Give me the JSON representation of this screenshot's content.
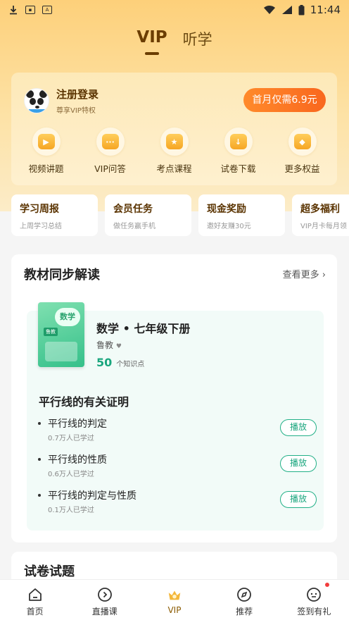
{
  "status_bar": {
    "time": "11:44",
    "left_icons": [
      "download-icon",
      "app-badge-icon",
      "a-icon"
    ],
    "right_icons": [
      "wifi-icon",
      "signal-icon",
      "battery-icon"
    ]
  },
  "top_tabs": [
    {
      "label": "VIP",
      "active": true
    },
    {
      "label": "听学",
      "active": false
    }
  ],
  "vip_card": {
    "login_title": "注册登录",
    "login_subtitle": "尊享VIP特权",
    "first_month_button": "首月仅需6.9元",
    "benefits": [
      {
        "label": "视频讲题",
        "icon": "video-icon"
      },
      {
        "label": "VIP问答",
        "icon": "chat-icon"
      },
      {
        "label": "考点课程",
        "icon": "star-icon"
      },
      {
        "label": "试卷下载",
        "icon": "download-icon"
      },
      {
        "label": "更多权益",
        "icon": "gift-icon"
      }
    ]
  },
  "quick_cards": [
    {
      "title": "学习周报",
      "subtitle": "上周学习总结"
    },
    {
      "title": "会员任务",
      "subtitle": "做任务赢手机"
    },
    {
      "title": "现金奖励",
      "subtitle": "邀好友赚30元"
    },
    {
      "title": "超多福利",
      "subtitle": "VIP月卡每月领"
    }
  ],
  "textbook_section": {
    "title": "教材同步解读",
    "see_more": "查看更多",
    "book": {
      "cover_badge": "数学",
      "cover_tag": "鲁教",
      "name": "数学 • 七年级下册",
      "publisher": "鲁教",
      "knowledge_count": "50",
      "knowledge_unit": "个知识点"
    },
    "chapter_title": "平行线的有关证明",
    "lessons": [
      {
        "name": "平行线的判定",
        "learners": "0.7万人已学过",
        "button": "播放"
      },
      {
        "name": "平行线的性质",
        "learners": "0.6万人已学过",
        "button": "播放"
      },
      {
        "name": "平行线的判定与性质",
        "learners": "0.1万人已学过",
        "button": "播放"
      }
    ]
  },
  "exam_section": {
    "title": "试卷试题"
  },
  "bottom_nav": [
    {
      "label": "首页",
      "icon": "home-icon"
    },
    {
      "label": "直播课",
      "icon": "live-icon"
    },
    {
      "label": "VIP",
      "icon": "crown-icon",
      "active": true
    },
    {
      "label": "推荐",
      "icon": "compass-icon"
    },
    {
      "label": "签到有礼",
      "icon": "checkin-icon"
    }
  ]
}
